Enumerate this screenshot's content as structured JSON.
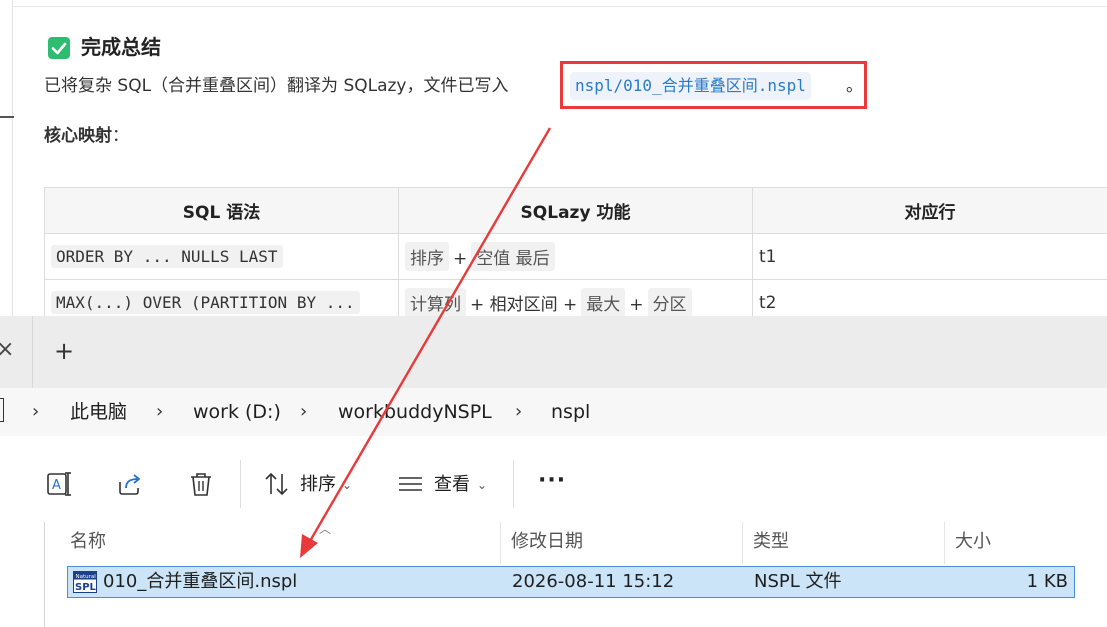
{
  "chat": {
    "heading": "完成总结",
    "summary_prefix": "已将复杂 SQL（合并重叠区间）翻译为 SQLazy，文件已写入",
    "file_path": "nspl/010_合并重叠区间.nspl",
    "summary_suffix": "。",
    "subheading": "核心映射",
    "subheading_colon": "：",
    "table": {
      "headers": [
        "SQL 语法",
        "SQLazy 功能",
        "对应行"
      ],
      "rows": [
        {
          "sql": "ORDER BY ... NULLS LAST",
          "feature": [
            "排序",
            "+",
            "空值 最后"
          ],
          "line": "t1"
        },
        {
          "sql": "MAX(...) OVER (PARTITION BY ...",
          "feature": [
            "计算列",
            "+ 相对区间 +",
            "最大",
            "+",
            "分区"
          ],
          "line": "t2"
        }
      ]
    }
  },
  "explorer": {
    "tab_close_glyph": "×",
    "tab_new_glyph": "+",
    "breadcrumbs": [
      "此电脑",
      "work (D:)",
      "workbuddyNSPL",
      "nspl"
    ],
    "crumb_separator": "›",
    "commands": {
      "sort_label": "排序",
      "view_label": "查看",
      "more_glyph": "···"
    },
    "columns": [
      "名称",
      "修改日期",
      "类型",
      "大小"
    ],
    "files": [
      {
        "name": "010_合并重叠区间.nspl",
        "modified": "2026-08-11 15:12",
        "type": "NSPL 文件",
        "size": "1 KB",
        "icon_badge_top": "Natural",
        "icon_badge_bottom": "SPL"
      }
    ]
  },
  "colors": {
    "highlight": "#e83a3a",
    "arrow": "#e83a3a",
    "code_text": "#2a7bc8",
    "selection_fill": "#cce4f7",
    "selection_border": "#4a8fd8",
    "check_green": "#2dbd6e"
  },
  "icons": [
    "check-icon",
    "rename-icon",
    "share-icon",
    "delete-icon",
    "sort-icon",
    "view-icon",
    "chevron-down-icon",
    "more-icon",
    "nspl-file-icon"
  ]
}
